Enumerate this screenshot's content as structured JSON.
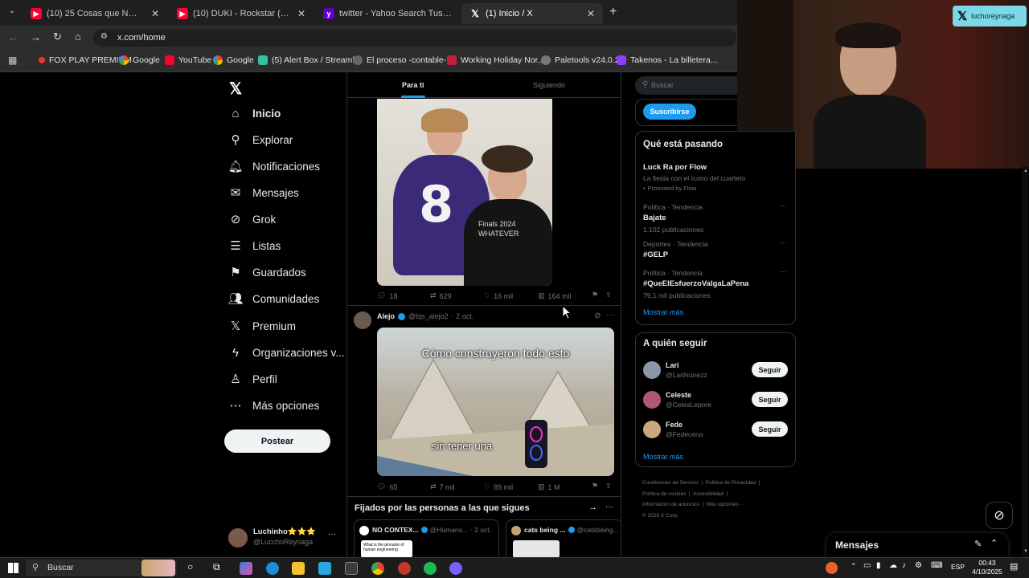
{
  "browser": {
    "tabs": [
      {
        "title": "(10) 25 Cosas que NO Sabías hac",
        "icon": "youtube-icon"
      },
      {
        "title": "(10) DUKI - Rockstar (Video Oficial",
        "icon": "youtube-icon"
      },
      {
        "title": "twitter - Yahoo Search Tus resultad",
        "icon": "yahoo-icon"
      },
      {
        "title": "(1) Inicio / X",
        "icon": "x-icon"
      }
    ],
    "new_tab": "+",
    "url": "x.com/home",
    "bookmarks": [
      "FOX PLAY PREMIUM",
      "Google",
      "YouTube",
      "Google",
      "(5) Alert Box / Streaml...",
      "El proceso -contable-...",
      "Working Holiday Nor...",
      "Paletools v24.0.29",
      "Takenos - La billetera..."
    ]
  },
  "sidebar": {
    "items": [
      {
        "label": "Inicio",
        "icon": "home-icon"
      },
      {
        "label": "Explorar",
        "icon": "search-icon"
      },
      {
        "label": "Notificaciones",
        "icon": "bell-icon"
      },
      {
        "label": "Mensajes",
        "icon": "mail-icon"
      },
      {
        "label": "Grok",
        "icon": "grok-icon"
      },
      {
        "label": "Listas",
        "icon": "list-icon"
      },
      {
        "label": "Guardados",
        "icon": "bookmark-icon"
      },
      {
        "label": "Comunidades",
        "icon": "people-icon"
      },
      {
        "label": "Premium",
        "icon": "x-icon"
      },
      {
        "label": "Organizaciones v...",
        "icon": "bolt-icon"
      },
      {
        "label": "Perfil",
        "icon": "person-icon"
      },
      {
        "label": "Más opciones",
        "icon": "more-icon"
      }
    ],
    "post_button": "Postear",
    "account": {
      "name": "Luchinho⭐⭐⭐",
      "handle": "@LucchoReynaga",
      "more": "···"
    }
  },
  "feed": {
    "tabs": [
      "Para ti",
      "Siguiendo"
    ],
    "post1": {
      "replies": "18",
      "reposts": "629",
      "likes": "16 mil",
      "views": "164 mil",
      "shirt_number": "8",
      "shirt_text": "Finals 2024 WHATEVER"
    },
    "post2": {
      "author": "Alejo",
      "handle": "@bjs_alejo2",
      "date": "· 2 oct.",
      "caption_top": "Cómo construyeron todo esto",
      "caption_bottom": "sin tener una",
      "replies": "65",
      "reposts": "7 mil",
      "likes": "89 mil",
      "views": "1 M"
    },
    "pinned": {
      "title": "Fijados por las personas a las que sigues",
      "card1": {
        "author": "NO CONTEX...",
        "handle": "@Humans...",
        "date": "· 2 oct.",
        "thumb_text": "What is the pinnacle of human engineering"
      },
      "card2": {
        "author": "cats being ...",
        "handle": "@catsbeing..."
      }
    }
  },
  "right": {
    "search_placeholder": "Buscar",
    "subscribe": "Suscribirse",
    "trends_title": "Qué está pasando",
    "promo": {
      "name": "Luck Ra por Flow",
      "desc": "La fiesta con el ícono del cuarteto",
      "promoted": "Promoted by Flow"
    },
    "trends": [
      {
        "meta": "Política · Tendencia",
        "name": "Bajate",
        "count": "1.102 publicaciones"
      },
      {
        "meta": "Deportes · Tendencia",
        "name": "#GELP",
        "count": ""
      },
      {
        "meta": "Política · Tendencia",
        "name": "#QueElEsfuerzoValgaLaPena",
        "count": "79,1 mil publicaciones"
      }
    ],
    "show_more": "Mostrar más",
    "follow_title": "A quién seguir",
    "follow": [
      {
        "name": "Lari",
        "handle": "@LariNunezz",
        "button": "Seguir"
      },
      {
        "name": "Celeste",
        "handle": "@CelesLepore",
        "button": "Seguir"
      },
      {
        "name": "Fede",
        "handle": "@Fedecena",
        "button": "Seguir"
      }
    ],
    "footer": [
      "Condiciones de Servicio",
      "Política de Privacidad",
      "Política de cookies",
      "Accesibilidad",
      "Información de anuncios",
      "Más opciones ···",
      "© 2025 X Corp."
    ]
  },
  "messages_drawer": {
    "title": "Mensajes"
  },
  "webcam": {
    "badge": "luchoreynaga"
  },
  "taskbar": {
    "search": "Buscar",
    "lang": "ESP",
    "time": "00:43",
    "date": "4/10/2025"
  }
}
